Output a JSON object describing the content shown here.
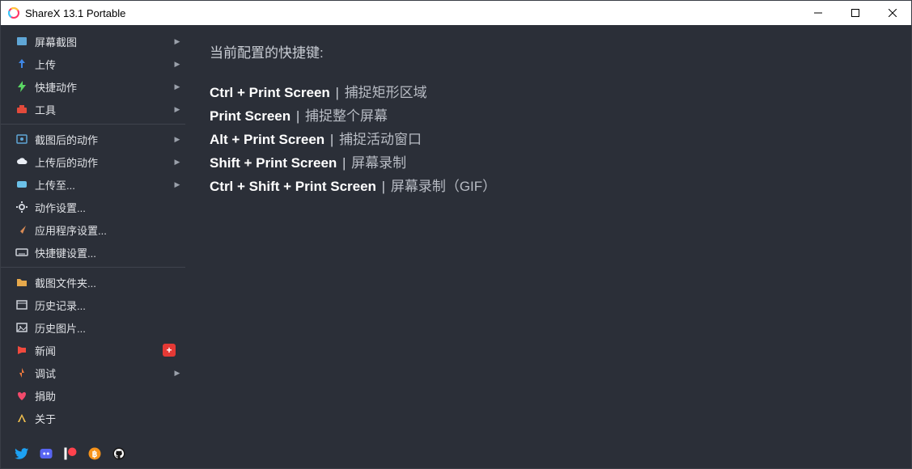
{
  "window": {
    "title": "ShareX 13.1 Portable"
  },
  "sidebar": {
    "groups": [
      [
        {
          "icon": "screenshot-icon",
          "color": "#5fa6d6",
          "label": "屏幕截图",
          "arrow": true
        },
        {
          "icon": "upload-icon",
          "color": "#3f87e6",
          "label": "上传",
          "arrow": true
        },
        {
          "icon": "lightning-icon",
          "color": "#5bd864",
          "label": "快捷动作",
          "arrow": true
        },
        {
          "icon": "toolbox-icon",
          "color": "#e24a3b",
          "label": "工具",
          "arrow": true
        }
      ],
      [
        {
          "icon": "after-capture-icon",
          "color": "#5fa6d6",
          "label": "截图后的动作",
          "arrow": true
        },
        {
          "icon": "cloud-icon",
          "color": "#eaeef5",
          "label": "上传后的动作",
          "arrow": true
        },
        {
          "icon": "destination-icon",
          "color": "#6bc1e8",
          "label": "上传至...",
          "arrow": true
        },
        {
          "icon": "gear-icon",
          "color": "#cfd3db",
          "label": "动作设置...",
          "arrow": false
        },
        {
          "icon": "app-settings-icon",
          "color": "#d98b55",
          "label": "应用程序设置...",
          "arrow": false
        },
        {
          "icon": "keyboard-icon",
          "color": "#cfd3db",
          "label": "快捷键设置...",
          "arrow": false
        }
      ],
      [
        {
          "icon": "folder-icon",
          "color": "#e7a94c",
          "label": "截图文件夹...",
          "arrow": false
        },
        {
          "icon": "history-icon",
          "color": "#cfd3db",
          "label": "历史记录...",
          "arrow": false
        },
        {
          "icon": "image-history-icon",
          "color": "#cfd3db",
          "label": "历史图片...",
          "arrow": false
        },
        {
          "icon": "news-icon",
          "color": "#f04a3e",
          "label": "新闻",
          "arrow": false,
          "badge": "+"
        },
        {
          "icon": "debug-icon",
          "color": "#f07b3e",
          "label": "调试",
          "arrow": true
        },
        {
          "icon": "donate-icon",
          "color": "#f24a6b",
          "label": "捐助",
          "arrow": false
        },
        {
          "icon": "about-icon",
          "color": "#f2c14e",
          "label": "关于",
          "arrow": false
        }
      ]
    ]
  },
  "content": {
    "heading": "当前配置的快捷键:",
    "hotkeys": [
      {
        "key": "Ctrl + Print Screen",
        "desc": "捕捉矩形区域"
      },
      {
        "key": "Print Screen",
        "desc": "捕捉整个屏幕"
      },
      {
        "key": "Alt + Print Screen",
        "desc": "捕捉活动窗口"
      },
      {
        "key": "Shift + Print Screen",
        "desc": "屏幕录制"
      },
      {
        "key": "Ctrl + Shift + Print Screen",
        "desc": "屏幕录制（GIF）"
      }
    ]
  },
  "social": [
    "twitter",
    "discord",
    "patreon",
    "bitcoin",
    "github"
  ]
}
